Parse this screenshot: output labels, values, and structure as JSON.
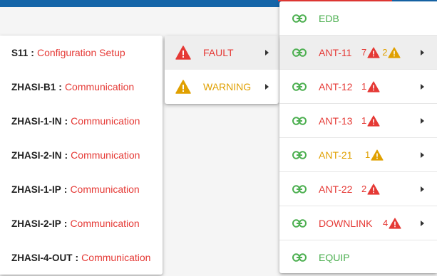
{
  "source_menu": {
    "items": [
      {
        "source": "S11",
        "separator": ":",
        "description": "Configuration Setup"
      },
      {
        "source": "ZHASI-B1",
        "separator": ":",
        "description": "Communication"
      },
      {
        "source": "ZHASI-1-IN",
        "separator": ":",
        "description": "Communication"
      },
      {
        "source": "ZHASI-2-IN",
        "separator": ":",
        "description": "Communication"
      },
      {
        "source": "ZHASI-1-IP",
        "separator": ":",
        "description": "Communication"
      },
      {
        "source": "ZHASI-2-IP",
        "separator": ":",
        "description": "Communication"
      },
      {
        "source": "ZHASI-4-OUT",
        "separator": ":",
        "description": "Communication"
      }
    ]
  },
  "severity_menu": {
    "items": [
      {
        "label": "FAULT",
        "icon": "fault-triangle-icon",
        "color": "#e53935"
      },
      {
        "label": "WARNING",
        "icon": "warning-triangle-icon",
        "color": "#e0a000"
      }
    ]
  },
  "node_menu": {
    "items": [
      {
        "label": "EDB",
        "icon": "link-icon",
        "fault_count": "",
        "warning_count": "",
        "has_submenu": false
      },
      {
        "label": "ANT-11",
        "icon": "link-icon",
        "fault_count": "7",
        "warning_count": "2",
        "has_submenu": true
      },
      {
        "label": "ANT-12",
        "icon": "link-icon",
        "fault_count": "1",
        "warning_count": "",
        "has_submenu": true
      },
      {
        "label": "ANT-13",
        "icon": "link-icon",
        "fault_count": "1",
        "warning_count": "",
        "has_submenu": true
      },
      {
        "label": "ANT-21",
        "icon": "link-icon",
        "fault_count": "",
        "warning_count": "1",
        "has_submenu": true
      },
      {
        "label": "ANT-22",
        "icon": "link-icon",
        "fault_count": "2",
        "warning_count": "",
        "has_submenu": true
      },
      {
        "label": "DOWNLINK",
        "icon": "link-icon",
        "fault_count": "4",
        "warning_count": "",
        "has_submenu": true
      },
      {
        "label": "EQUIP",
        "icon": "link-icon",
        "fault_count": "",
        "warning_count": "",
        "has_submenu": false
      }
    ]
  },
  "colors": {
    "fault": "#e53935",
    "warning": "#e0a000",
    "ok": "#4caf50",
    "header": "#1565a8"
  }
}
